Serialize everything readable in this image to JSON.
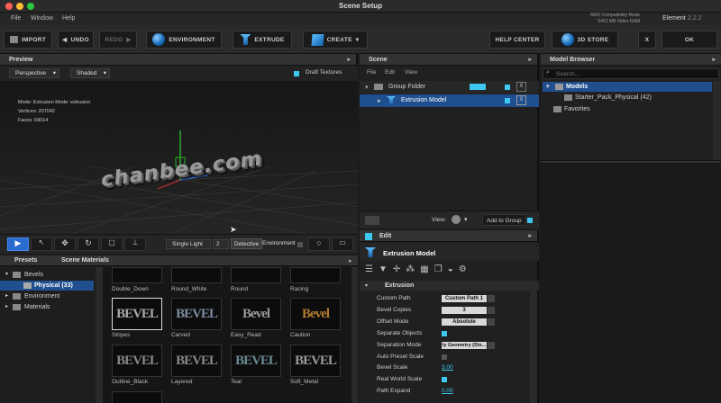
{
  "window": {
    "title": "Scene Setup",
    "right_info_1": "AMD Compatibility Mode",
    "right_info_2": "5461 MB Video RAM",
    "app_name": "Element",
    "version": "2.2.2"
  },
  "menu": [
    "File",
    "Window",
    "Help"
  ],
  "toolbar": {
    "import": "IMPORT",
    "undo": "UNDO",
    "redo": "REDO",
    "environment": "ENVIRONMENT",
    "extrude": "EXTRUDE",
    "create": "CREATE",
    "help": "HELP CENTER",
    "store": "3D STORE",
    "close": "X",
    "ok": "OK"
  },
  "preview": {
    "title": "Preview",
    "view_mode": "Perspective",
    "shade_mode": "Shaded",
    "draft_label": "Draft Textures",
    "stats": {
      "mode_label": "Mode:",
      "mode_value": "Extrusion Mode: extrusion",
      "vertices_label": "Vertices:",
      "vertices_value": "207042",
      "faces_label": "Faces:",
      "faces_value": "69014"
    },
    "object_text": "chanbee.com",
    "light": "Single Light",
    "light_num": "2",
    "environment": "Environment",
    "tooltip": "Detective"
  },
  "scene": {
    "title": "Scene",
    "menu": [
      "File",
      "Edit",
      "View"
    ],
    "folder": "Group Folder",
    "model": "Extrusion Model",
    "view_label": "View:",
    "add_group": "Add to Group"
  },
  "model_browser": {
    "title": "Model Browser",
    "search_placeholder": "Search...",
    "models": "Models",
    "starter": "Starter_Pack_Physical (42)",
    "favorites": "Favorites"
  },
  "edit": {
    "title": "Edit",
    "model_name": "Extrusion Model",
    "section": "Extrusion",
    "props": [
      {
        "label": "Custom Path",
        "value": "Custom Path 1"
      },
      {
        "label": "Bevel Copies",
        "value": "3"
      },
      {
        "label": "Offset Mode",
        "value": "Absolute"
      },
      {
        "label": "Separate Objects",
        "value": ""
      },
      {
        "label": "Separation Mode",
        "value": "ly Geometry (Slo..."
      },
      {
        "label": "Auto Preset Scale",
        "value": ""
      },
      {
        "label": "Bevel Scale",
        "value": "3.00"
      },
      {
        "label": "Real World Scale",
        "value": ""
      },
      {
        "label": "Path Expand",
        "value": "0.00"
      }
    ]
  },
  "presets": {
    "tabs": [
      "Presets",
      "Scene Materials"
    ],
    "tree": [
      "Bevels",
      "Physical (33)",
      "Environment",
      "Materials"
    ],
    "top_labels": [
      "Double_Down",
      "Round_White",
      "Round",
      "Racing"
    ],
    "tiles": [
      {
        "text": "BEVEL",
        "label": "Stripes"
      },
      {
        "text": "BEVEL",
        "label": "Carved"
      },
      {
        "text": "Bevel",
        "label": "Easy_Read"
      },
      {
        "text": "Bevel",
        "label": "Caution"
      },
      {
        "text": "BEVEL",
        "label": "Outline_Black"
      },
      {
        "text": "BEVEL",
        "label": "Layered"
      },
      {
        "text": "BEVEL",
        "label": "Teal"
      },
      {
        "text": "BEVEL",
        "label": "Soft_Metal"
      }
    ]
  },
  "colors": {
    "accent": "#3cc8f0",
    "selection": "#1f4f8f"
  }
}
